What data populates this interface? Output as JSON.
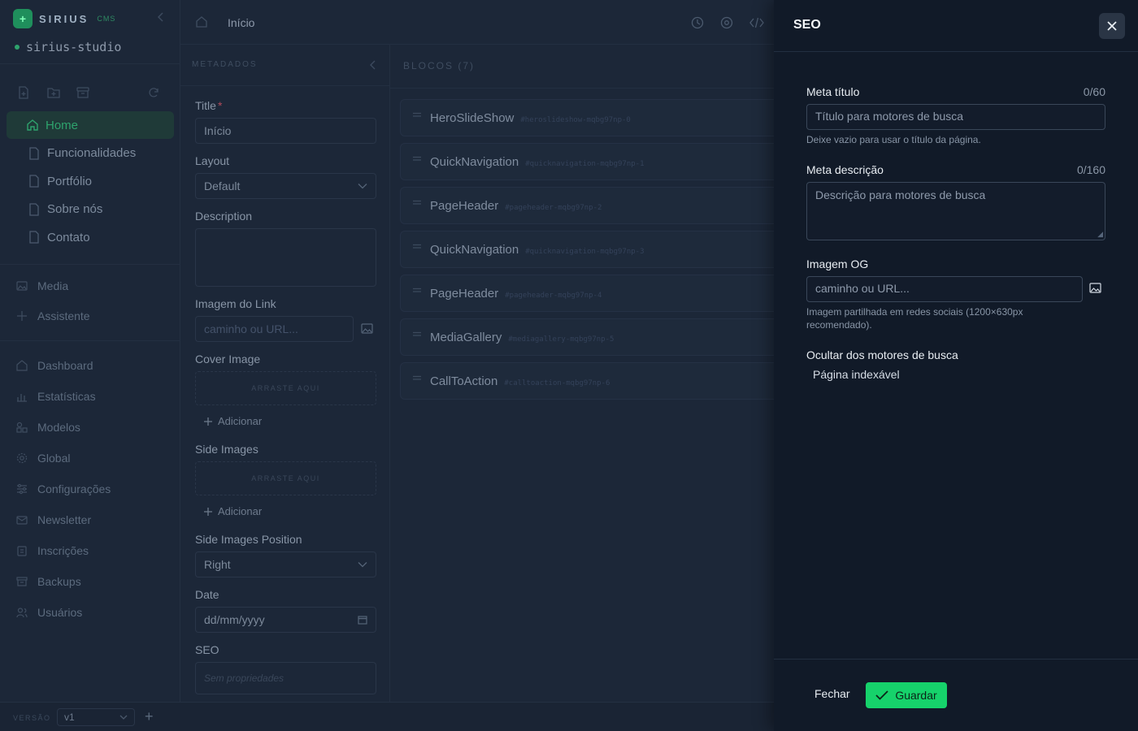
{
  "brand": {
    "name": "SIRIUS",
    "tag": "CMS"
  },
  "site": {
    "name": "sirius-studio"
  },
  "pages": [
    {
      "label": "Home",
      "active": true
    },
    {
      "label": "Funcionalidades",
      "active": false
    },
    {
      "label": "Portfólio",
      "active": false
    },
    {
      "label": "Sobre nós",
      "active": false
    },
    {
      "label": "Contato",
      "active": false
    }
  ],
  "sidebar_tools": [
    "Media",
    "Assistente"
  ],
  "nav": [
    "Dashboard",
    "Estatísticas",
    "Modelos",
    "Global",
    "Configurações",
    "Newsletter",
    "Inscrições",
    "Backups",
    "Usuários"
  ],
  "version": {
    "label": "VERSÃO",
    "value": "v1"
  },
  "header": {
    "breadcrumb": "Início"
  },
  "metadata": {
    "heading": "METADADOS",
    "title_label": "Title",
    "title_required": "*",
    "title_value": "Início",
    "layout_label": "Layout",
    "layout_value": "Default",
    "description_label": "Description",
    "link_image_label": "Imagem do Link",
    "link_image_placeholder": "caminho ou URL...",
    "cover_label": "Cover Image",
    "dropzone_text": "ARRASTE AQUI",
    "add_label": "Adicionar",
    "side_images_label": "Side Images",
    "side_pos_label": "Side Images Position",
    "side_pos_value": "Right",
    "date_label": "Date",
    "date_placeholder": "dd/mm/yyyy",
    "seo_label": "SEO",
    "seo_value": "Sem propriedades"
  },
  "blocks": {
    "heading": "BLOCOS (7)",
    "items": [
      {
        "name": "HeroSlideShow",
        "id": "#heroslideshow-mqbg97np-0"
      },
      {
        "name": "QuickNavigation",
        "id": "#quicknavigation-mqbg97np-1"
      },
      {
        "name": "PageHeader",
        "id": "#pageheader-mqbg97np-2"
      },
      {
        "name": "QuickNavigation",
        "id": "#quicknavigation-mqbg97np-3"
      },
      {
        "name": "PageHeader",
        "id": "#pageheader-mqbg97np-4"
      },
      {
        "name": "MediaGallery",
        "id": "#mediagallery-mqbg97np-5"
      },
      {
        "name": "CallToAction",
        "id": "#calltoaction-mqbg97np-6"
      }
    ]
  },
  "seo": {
    "title": "SEO",
    "meta_title_label": "Meta título",
    "meta_title_count": "0/60",
    "meta_title_placeholder": "Título para motores de busca",
    "meta_title_help": "Deixe vazio para usar o título da página.",
    "meta_desc_label": "Meta descrição",
    "meta_desc_count": "0/160",
    "meta_desc_placeholder": "Descrição para motores de busca",
    "og_label": "Imagem OG",
    "og_placeholder": "caminho ou URL...",
    "og_help": "Imagem partilhada em redes sociais (1200×630px recomendado).",
    "hide_label": "Ocultar dos motores de busca",
    "indexable_label": "Página indexável",
    "cancel_label": "Fechar",
    "save_label": "Guardar"
  },
  "colors": {
    "accent": "#16d26b",
    "active_page": "#2ea36d",
    "drawer_bg": "#111a28",
    "backdrop": "#1c2738"
  }
}
